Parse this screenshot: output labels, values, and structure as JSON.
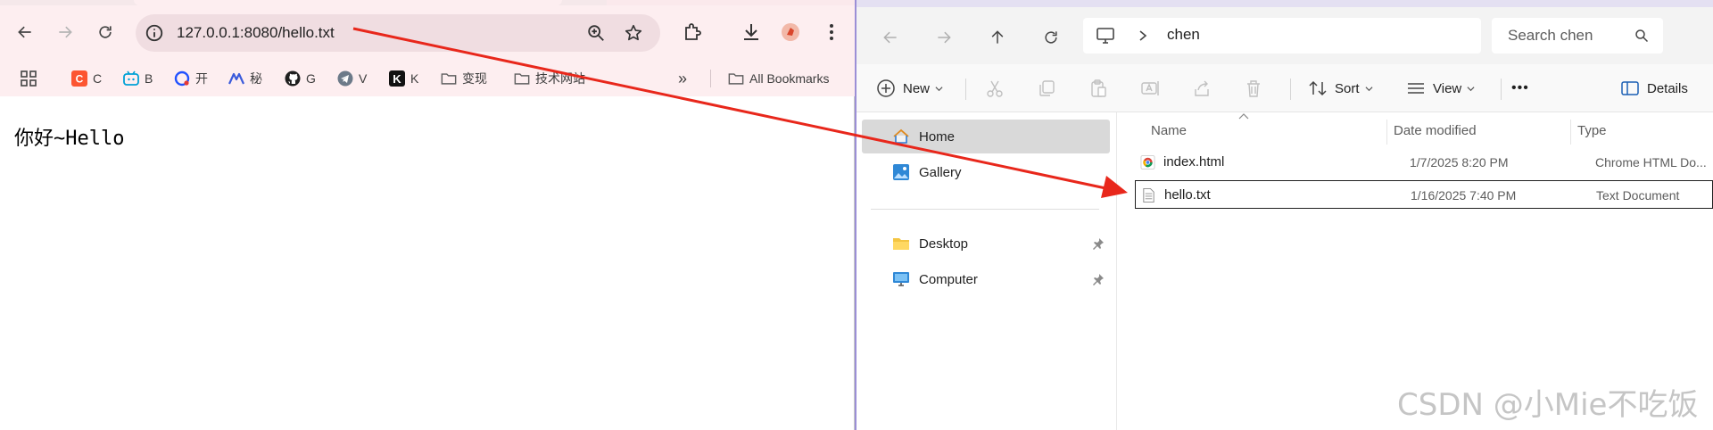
{
  "browser": {
    "url": "127.0.0.1:8080/hello.txt",
    "bookmarks": [
      {
        "icon": "csdn-icon",
        "label": "C",
        "color": "#fc5531"
      },
      {
        "icon": "bilibili-icon",
        "label": "B",
        "color": "#00a1d6"
      },
      {
        "icon": "kai-icon",
        "label": "开",
        "color": "#2152ff"
      },
      {
        "icon": "mi-icon",
        "label": "秘",
        "color": "#3b5bdb"
      },
      {
        "icon": "github-icon",
        "label": "G",
        "color": "#1f1f1f"
      },
      {
        "icon": "telegram-icon",
        "label": "V",
        "color": "#6c7a89"
      },
      {
        "icon": "k-icon",
        "label": "K",
        "color": "#111111"
      },
      {
        "icon": "folder-icon",
        "label": "变现",
        "color": "#5f5f5f"
      },
      {
        "icon": "folder-icon",
        "label": "技术网站",
        "color": "#5f5f5f"
      }
    ],
    "overflow": "»",
    "all_bookmarks": "All Bookmarks",
    "page_content": "你好~Hello"
  },
  "explorer": {
    "breadcrumb": "chen",
    "search_placeholder": "Search chen",
    "commands": {
      "new": "New",
      "sort": "Sort",
      "view": "View",
      "more": "•••",
      "details": "Details"
    },
    "nav": [
      {
        "label": "Home",
        "selected": true,
        "icon": "home-icon"
      },
      {
        "label": "Gallery",
        "selected": false,
        "icon": "gallery-icon"
      },
      {
        "label": "Desktop",
        "selected": false,
        "icon": "desktop-folder-icon",
        "pinned": true
      },
      {
        "label": "Computer",
        "selected": false,
        "icon": "computer-icon",
        "pinned": true
      }
    ],
    "columns": {
      "name": "Name",
      "date": "Date modified",
      "type": "Type"
    },
    "files": [
      {
        "name": "index.html",
        "date": "1/7/2025 8:20 PM",
        "type": "Chrome HTML Do..."
      },
      {
        "name": "hello.txt",
        "date": "1/16/2025 7:40 PM",
        "type": "Text Document"
      }
    ]
  },
  "watermark": "CSDN @小Mie不吃饭",
  "colors": {
    "arrow": "#e8271b",
    "chrome_toolbar": "#fdeef0",
    "explorer_accent": "#9b8fd6"
  }
}
